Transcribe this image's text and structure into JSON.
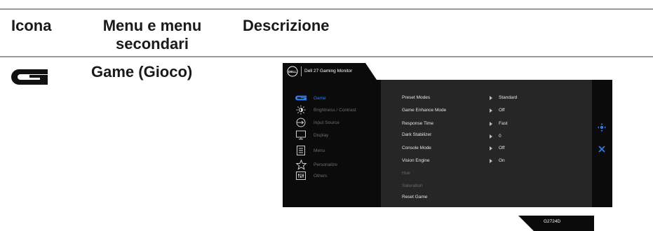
{
  "table": {
    "header_icon": "Icona",
    "header_menu": "Menu e menu secondari",
    "header_menu_line1": "Menu e menu",
    "header_menu_line2": "secondari",
    "header_description": "Descrizione"
  },
  "row": {
    "icon": "game-g-icon",
    "title": "Game (Gioco)"
  },
  "osd": {
    "tab_title": "Dell 27 Gaming Monitor",
    "logo": "DELL",
    "nav": [
      {
        "label": "Game",
        "icon": "game-g-icon",
        "active": true
      },
      {
        "label": "Brightness / Contrast",
        "icon": "brightness-icon"
      },
      {
        "label": "Input Source",
        "icon": "input-source-icon"
      },
      {
        "label": "Display",
        "icon": "display-icon"
      },
      {
        "label": "Menu",
        "icon": "menu-icon"
      },
      {
        "label": "Personalize",
        "icon": "star-icon"
      },
      {
        "label": "Others",
        "icon": "others-icon"
      }
    ],
    "options": [
      {
        "label": "Preset Modes",
        "value": "Standard"
      },
      {
        "label": "Game Enhance Mode",
        "value": "Off"
      },
      {
        "label": "Response Time",
        "value": "Fast"
      },
      {
        "label": "Dark Stabilizer",
        "value": "0"
      },
      {
        "label": "Console Mode",
        "value": "Off"
      },
      {
        "label": "Vision Engine",
        "value": "On"
      },
      {
        "label": "Hue",
        "value": ""
      },
      {
        "label": "Saturation",
        "value": ""
      },
      {
        "label": "Reset Game",
        "value": ""
      }
    ],
    "model": "G2724D",
    "colors": {
      "accent": "#2f7ff0",
      "panel_dark": "#0b0b0b",
      "panel_mid": "#262626"
    }
  }
}
